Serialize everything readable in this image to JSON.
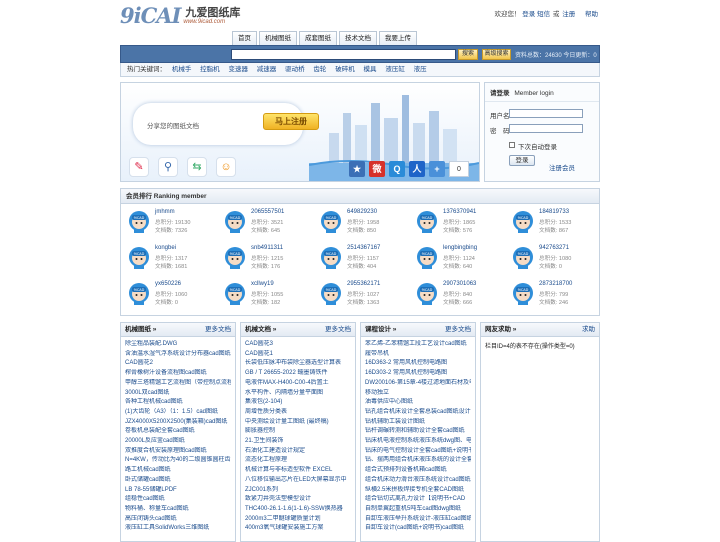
{
  "logo": {
    "mark": "9iCAI",
    "name": "九爱图纸库",
    "url": "www.9icad.com"
  },
  "toplinks": {
    "greeting": "欢迎您！",
    "login": "登录",
    "sms": "短信",
    "or": "或",
    "register": "注册",
    "help": "帮助"
  },
  "nav": [
    "首页",
    "机械图纸",
    "成套图纸",
    "技术文档",
    "我要上传"
  ],
  "search": {
    "placeholder": "",
    "btn": "搜索",
    "adv": "高级搜索",
    "info": "资料总数：24630 今日更新：0"
  },
  "hot": {
    "label": "热门关键词：",
    "items": [
      "机械手",
      "控脂机",
      "变速器",
      "减速器",
      "驱动桥",
      "齿轮",
      "破碎机",
      "模具",
      "液压缸",
      "液压"
    ]
  },
  "banner": {
    "bubble": "分享您的图纸文档",
    "register": "马上注册",
    "count": "0"
  },
  "login": {
    "title": "请登录",
    "title_en": "Member login",
    "user": "用户名",
    "pass": "密　码",
    "auto": "下次自动登录",
    "btn": "登录",
    "reg": "注册会员"
  },
  "ranking": {
    "title": "会员排行 Ranking member",
    "members": [
      {
        "name": "jmhmm",
        "score": "总积分: 19130",
        "docs": "文档数: 7326"
      },
      {
        "name": "2065557501",
        "score": "总积分: 3521",
        "docs": "文档数: 645"
      },
      {
        "name": "649829230",
        "score": "总积分: 1958",
        "docs": "文档数: 850"
      },
      {
        "name": "1376370941",
        "score": "总积分: 1865",
        "docs": "文档数: 576"
      },
      {
        "name": "184819733",
        "score": "总积分: 1533",
        "docs": "文档数: 867"
      },
      {
        "name": "kongbei",
        "score": "总积分: 1317",
        "docs": "文档数: 1681"
      },
      {
        "name": "snb4911311",
        "score": "总积分: 1215",
        "docs": "文档数: 176"
      },
      {
        "name": "2514367167",
        "score": "总积分: 1157",
        "docs": "文档数: 404"
      },
      {
        "name": "lengbingbing",
        "score": "总积分: 1124",
        "docs": "文档数: 640"
      },
      {
        "name": "942763271",
        "score": "总积分: 1080",
        "docs": "文档数: 0"
      },
      {
        "name": "yx650226",
        "score": "总积分: 1060",
        "docs": "文档数: 0"
      },
      {
        "name": "xcllwy19",
        "score": "总积分: 1055",
        "docs": "文档数: 182"
      },
      {
        "name": "2955362171",
        "score": "总积分: 1027",
        "docs": "文档数: 1363"
      },
      {
        "name": "2907301063",
        "score": "总积分: 840",
        "docs": "文档数: 666"
      },
      {
        "name": "2873218700",
        "score": "总积分: 799",
        "docs": "文档数: 246"
      }
    ]
  },
  "cols": [
    {
      "title": "机械图纸 »",
      "more": "更多文档",
      "items": [
        "除尘粗品装配.DWG",
        "含油温水湿气浮系统设计分布器cad图纸",
        "CAD圆花2",
        "榨膏橡树汁设备流程图cad图纸",
        "甲醇三塔精馏工艺流程图（带控制点流程",
        "3000L双cad图纸",
        "各种工程机械cad图纸",
        "(1)大齿轮（A3）（1：1.5）cad图纸",
        "JZX4000X5200X2500(集装箱)cad图纸",
        "卷板机总装配全套cad图纸",
        "20000L反应釜cad图纸",
        "双推度合机安装原理图cad图纸",
        "N=4KW，传动比为40的二级圆锥圆柱齿",
        "路工机械cad图纸",
        "卧式储罐cad图纸",
        "LB 78-55储罐LPDF",
        "组稳性cad图纸",
        "物料桶、称量车cad图纸",
        "高压闭铸头cad图纸",
        "液压缸工具SolidWorks三维图纸"
      ]
    },
    {
      "title": "机械文档 »",
      "more": "更多文档",
      "items": [
        "CAD圆花3",
        "CAD圆花1",
        "长袋低压脉冲布袋除尘器选型计算表",
        "GB / T 26655-2022 蠕墨铸铁件",
        "电液伴MAX-H400-C00-4后置土",
        "水平构件、内隔墙分量平面图",
        "集液包(2-104)",
        "周增性质分类表",
        "中央测绘设计量工图纸 (最终稿)",
        "膨胀器控制",
        "21.卫生间装饰",
        "石油化工建造设计规定",
        "流态化工程原理",
        "机械计算与非标造型软件 EXCEL",
        "八位移位输出芯片在LED大屏幕显示中",
        "ZJC001系列",
        "致紧刀井壳法塑模型设计",
        "THC400-26.1-1.6(1-1.6)-SSW换热器",
        "2000m3二甲醚球罐质量计划",
        "400m3氧气球罐安装施工方案"
      ]
    },
    {
      "title": "课程设计 »",
      "more": "更多文档",
      "items": [
        "苯乙烯-乙苯精馏工段工艺设计cad图纸",
        "履带吊机",
        "16D363-2 常用风机控制电路图",
        "16D303-2 常用风机控制电路图",
        "DW200106-第15章-4楼过滤地面石材及电",
        "移动独立",
        "油毒供应中心图纸",
        "钻孔组合机床设计全套总装cad图纸设计",
        "钻机辅助工装设计图纸",
        "钻杆调碾转测和辅助设计全套cad图纸",
        "钻床机电液控制系统液压系统dwg图、电",
        "钻床的电气控制设计全套cad图纸+说明书",
        "钻、摆两用组合机床液压系统的设计全套",
        "组合式预排列设备机箱cad图纸",
        "组合机床动力滑台液压系统设计cad图纸",
        "纵横2.5米拼板焊接专机全套CAD图纸",
        "组合钻切式离孔力设计【说明书+CAD",
        "自制单翼起重机5吨车cad图dwg图纸",
        "自卸车液压举升系统设计-液压缸cad图纸",
        "自卸车设计(cad图纸+说明书)cad图纸"
      ]
    },
    {
      "title": "网友求助 »",
      "more": "求助",
      "text": "栏目ID=4的表不存在(操作类型=0)"
    }
  ]
}
